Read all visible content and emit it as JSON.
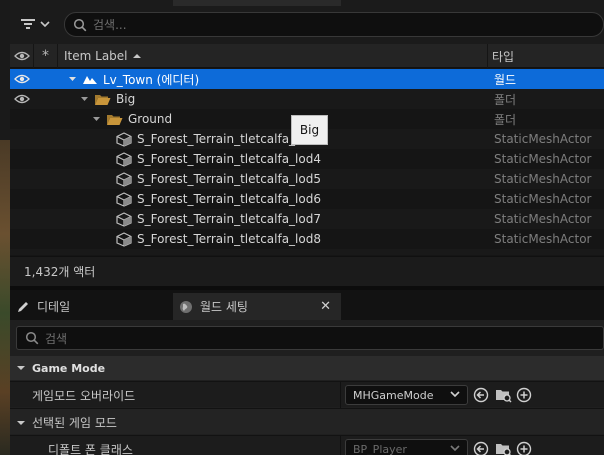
{
  "toolbar": {
    "search_placeholder": "검색..."
  },
  "outliner": {
    "columns": {
      "label": "Item Label",
      "type": "타입"
    },
    "rows": [
      {
        "label": "Lv_Town (에디터)",
        "type": "월드"
      },
      {
        "label": "Big",
        "type": "폴더"
      },
      {
        "label": "Ground",
        "type": "폴더"
      },
      {
        "label": "S_Forest_Terrain_tletcalfa_lod3",
        "type": "StaticMeshActor"
      },
      {
        "label": "S_Forest_Terrain_tletcalfa_lod4",
        "type": "StaticMeshActor"
      },
      {
        "label": "S_Forest_Terrain_tletcalfa_lod5",
        "type": "StaticMeshActor"
      },
      {
        "label": "S_Forest_Terrain_tletcalfa_lod6",
        "type": "StaticMeshActor"
      },
      {
        "label": "S_Forest_Terrain_tletcalfa_lod7",
        "type": "StaticMeshActor"
      },
      {
        "label": "S_Forest_Terrain_tletcalfa_lod8",
        "type": "StaticMeshActor"
      }
    ],
    "tooltip": "Big",
    "actor_count": "1,432개 액터"
  },
  "panel_tabs": {
    "details": "디테일",
    "world_settings": "월드 세팅"
  },
  "details": {
    "search_placeholder": "검색",
    "category": "Game Mode",
    "game_mode_override_label": "게임모드 오버라이드",
    "game_mode_override_value": "MHGameMode",
    "selected_game_mode_label": "선택된 게임 모드",
    "default_pawn_label": "디폴트 폰 클래스",
    "default_pawn_value": "BP_Player"
  },
  "colors": {
    "selection": "#0d6bd9",
    "folder": "#c8953a",
    "background": "#151515"
  }
}
